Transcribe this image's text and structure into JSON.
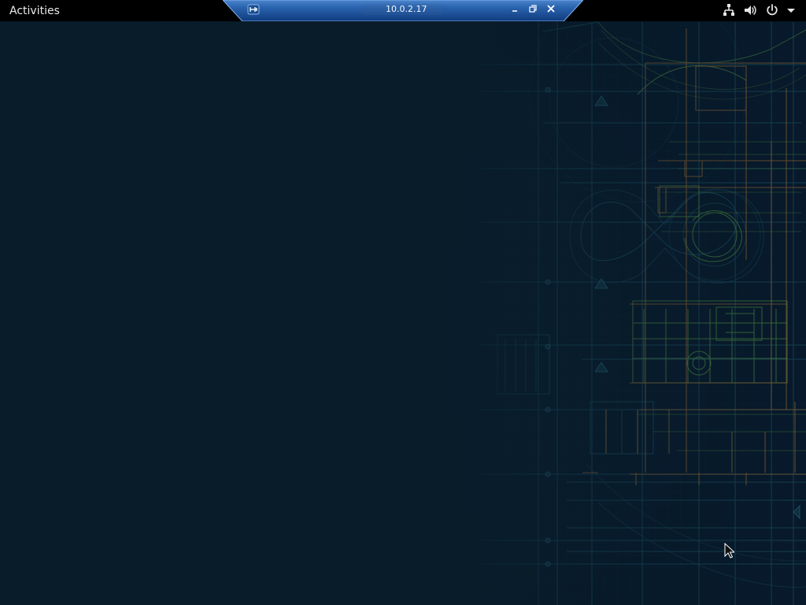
{
  "screen": {
    "type": "remote desktop session"
  },
  "topbar": {
    "activities_label": "Activities",
    "status_icons": [
      "network-icon",
      "volume-icon",
      "power-icon",
      "chevron-down-icon"
    ]
  },
  "remote_bar": {
    "host": "10.0.2.17",
    "buttons": [
      "pin-icon",
      "minimize-icon",
      "restore-icon",
      "close-icon"
    ]
  },
  "wallpaper": {
    "style": "dark blueprint",
    "colors": {
      "background": "#081c2a",
      "cyan": "#1e6b7a",
      "green": "#4f8a3f",
      "orange": "#9b6a32"
    }
  },
  "cursor": {
    "icon": "arrow-pointer-icon"
  }
}
